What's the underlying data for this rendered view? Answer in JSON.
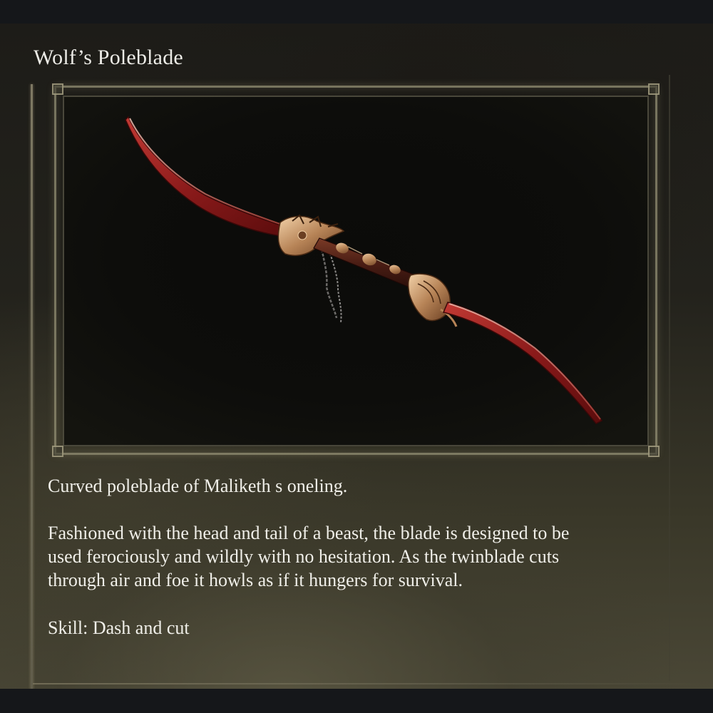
{
  "item": {
    "name": "Wolf’s Poleblade",
    "image_icon": "red-twinblade-poleblade-icon"
  },
  "description": {
    "line_intro": "Curved poleblade of Maliketh s oneling.",
    "paragraph_lines": [
      "Fashioned with the head and tail of a beast, the blade is designed to be",
      "used ferociously and wildly with no hesitation. As the twinblade cuts",
      "through air and foe it howls as if it hungers for survival."
    ],
    "skill_line": "Skill: Dash and cut"
  },
  "colors": {
    "text": "#f0efe9",
    "frame": "#96917a",
    "blade_red": "#8a1a1a"
  }
}
